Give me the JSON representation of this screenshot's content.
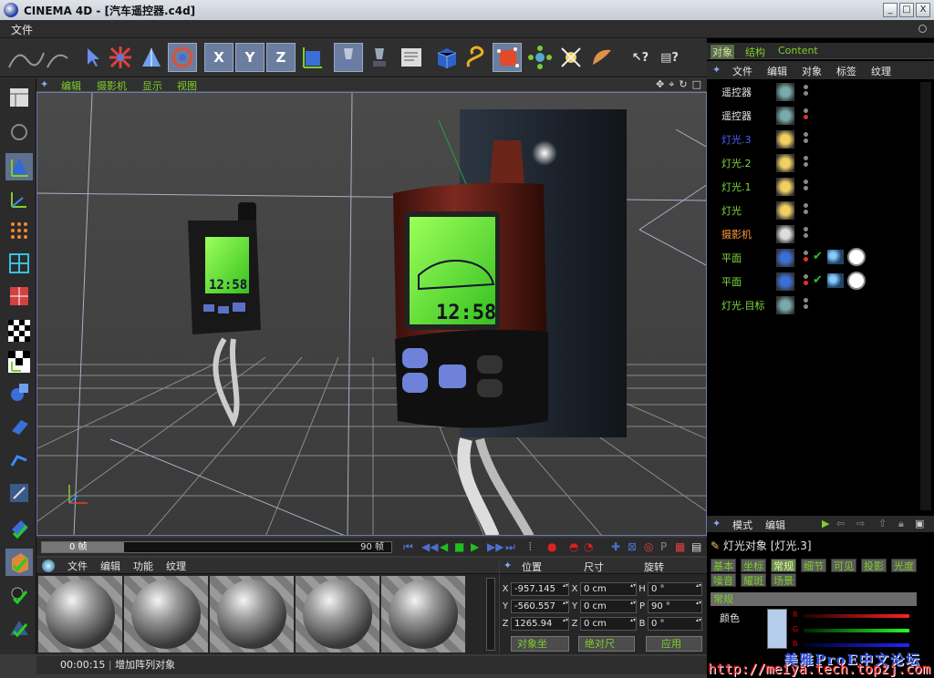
{
  "window": {
    "title": "CINEMA 4D - [汽车遥控器.c4d]",
    "controls": [
      "_",
      "□",
      "X"
    ]
  },
  "menubar": {
    "file": "文件"
  },
  "viewport": {
    "menu": [
      "编辑",
      "摄影机",
      "显示",
      "视图"
    ]
  },
  "timeline": {
    "current_frame": "0 帧",
    "end_frame": "90 帧"
  },
  "materials": {
    "menu": [
      "文件",
      "编辑",
      "功能",
      "纹理"
    ],
    "count": 5
  },
  "coordinates": {
    "headers": [
      "位置",
      "尺寸",
      "旋转"
    ],
    "rows": [
      {
        "axis": "X",
        "pos": "-957.145",
        "size_axis": "X",
        "size": "0 cm",
        "rot_axis": "H",
        "rot": "0 °"
      },
      {
        "axis": "Y",
        "pos": "-560.557",
        "size_axis": "Y",
        "size": "0 cm",
        "rot_axis": "P",
        "rot": "90 °"
      },
      {
        "axis": "Z",
        "pos": "1265.94",
        "size_axis": "Z",
        "size": "0 cm",
        "rot_axis": "B",
        "rot": "0 °"
      }
    ],
    "mode_object": "对象坐",
    "mode_size": "绝对尺",
    "apply": "应用"
  },
  "status": {
    "time": "00:00:15",
    "message": "增加阵列对象"
  },
  "object_manager": {
    "tabs": [
      "对象",
      "结构",
      "Content"
    ],
    "menu": [
      "文件",
      "编辑",
      "对象",
      "标签",
      "纹理"
    ],
    "objects": [
      {
        "name": "遥控器",
        "color": "#e6e6e6"
      },
      {
        "name": "遥控器",
        "color": "#e6e6e6"
      },
      {
        "name": "灯光.3",
        "color": "#4a62ff"
      },
      {
        "name": "灯光.2",
        "color": "#7fdc3a"
      },
      {
        "name": "灯光.1",
        "color": "#7fdc3a"
      },
      {
        "name": "灯光",
        "color": "#7fdc3a"
      },
      {
        "name": "摄影机",
        "color": "#ff9a3a"
      },
      {
        "name": "平面",
        "color": "#7fdc3a"
      },
      {
        "name": "平面",
        "color": "#7fdc3a"
      },
      {
        "name": "灯光.目标",
        "color": "#7fdc3a"
      }
    ]
  },
  "attributes": {
    "menu": [
      "模式",
      "编辑"
    ],
    "title": "灯光对象 [灯光.3]",
    "tabs_row1": [
      "基本",
      "坐标",
      "常规",
      "细节",
      "可见",
      "投影",
      "光度"
    ],
    "tabs_row2": [
      "噪音",
      "耀斑",
      "场景"
    ],
    "section": "常规",
    "color_label": "颜色",
    "channels": [
      "R",
      "G",
      "B"
    ]
  },
  "scene": {
    "lcd_time": "12:58"
  },
  "watermark": {
    "line1": "美雅ProE中文论坛",
    "line2": "http://meiya.tech.topzj.com"
  },
  "colors": {
    "accent_green": "#7fcf2a",
    "viewport_bg": "#3c3c3c",
    "selection": "#6c7e9f"
  }
}
